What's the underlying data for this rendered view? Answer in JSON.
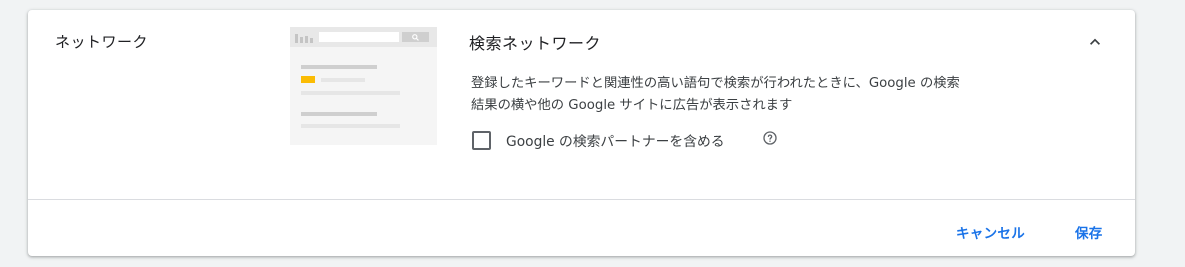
{
  "section": {
    "label": "ネットワーク"
  },
  "network": {
    "title": "検索ネットワーク",
    "description_line1": "登録したキーワードと関連性の高い語句で検索が行われたときに、Google の検索",
    "description_line2": "結果の横や他の Google サイトに広告が表示されます",
    "checkbox_label": "Google の検索パートナーを含める",
    "checkbox_checked": false
  },
  "actions": {
    "cancel_label": "キャンセル",
    "save_label": "保存"
  },
  "icons": {
    "collapse": "chevron-up-icon",
    "help": "help-circle-icon",
    "search": "search-icon"
  },
  "colors": {
    "accent": "#1a73e8",
    "ad_highlight": "#fbbc04",
    "text": "#202124",
    "background": "#f1f3f4"
  }
}
